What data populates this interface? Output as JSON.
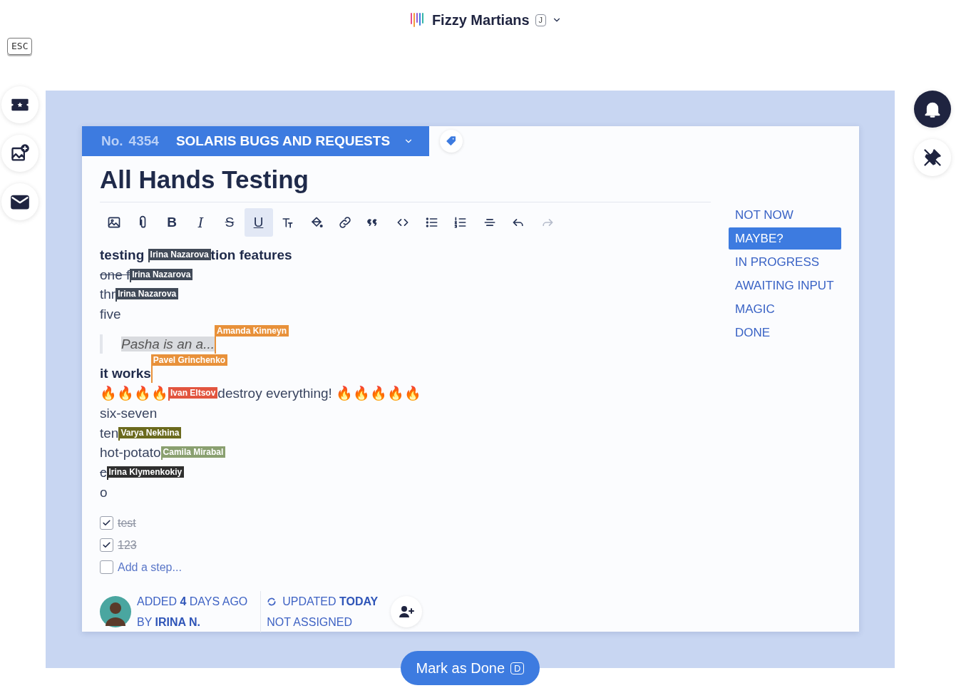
{
  "workspace": {
    "name": "Fizzy Martians",
    "shortcut": "J"
  },
  "escape_key": "ESC",
  "card": {
    "number_label": "No.",
    "number": "4354",
    "board": "SOLARIS BUGS AND REQUESTS",
    "title": "All Hands Testing"
  },
  "toolbar": [
    {
      "kind": "image",
      "active": false,
      "disabled": false
    },
    {
      "kind": "attach",
      "active": false,
      "disabled": false
    },
    {
      "kind": "letter",
      "label": "B",
      "active": false,
      "disabled": false
    },
    {
      "kind": "letter",
      "label": "I",
      "active": false,
      "disabled": false
    },
    {
      "kind": "letter",
      "label": "S",
      "active": false,
      "disabled": false
    },
    {
      "kind": "letter",
      "label": "U",
      "active": true,
      "disabled": false
    },
    {
      "kind": "textcolor",
      "active": false,
      "disabled": false
    },
    {
      "kind": "fill",
      "active": false,
      "disabled": false
    },
    {
      "kind": "link",
      "active": false,
      "disabled": false
    },
    {
      "kind": "quote",
      "active": false,
      "disabled": false
    },
    {
      "kind": "code",
      "active": false,
      "disabled": false
    },
    {
      "kind": "bullets",
      "active": false,
      "disabled": false
    },
    {
      "kind": "numbers",
      "active": false,
      "disabled": false
    },
    {
      "kind": "rule",
      "active": false,
      "disabled": false
    },
    {
      "kind": "undo",
      "active": false,
      "disabled": false
    },
    {
      "kind": "redo",
      "active": false,
      "disabled": true
    }
  ],
  "lines": [
    {
      "kind": "heading",
      "parts": [
        {
          "kind": "text",
          "text": "testing "
        },
        {
          "kind": "flag",
          "name": "Irina Nazarova",
          "color": "#414a58"
        },
        {
          "kind": "text",
          "text": "tion features"
        }
      ]
    },
    {
      "kind": "strike",
      "parts": [
        {
          "kind": "text",
          "text": "one f"
        },
        {
          "kind": "flag",
          "name": "Irina Nazarova",
          "color": "#414a58"
        }
      ]
    },
    {
      "kind": "plain",
      "parts": [
        {
          "kind": "text",
          "text": "thr"
        },
        {
          "kind": "flag",
          "name": "Irina Nazarova",
          "color": "#414a58"
        }
      ]
    },
    {
      "kind": "plain",
      "parts": [
        {
          "kind": "text",
          "text": "five"
        }
      ]
    },
    {
      "kind": "quote",
      "parts": [
        {
          "kind": "text",
          "text": "Pasha is an a..."
        },
        {
          "kind": "caret",
          "name": "Amanda Kinneyn",
          "color": "#e8913a"
        }
      ]
    },
    {
      "kind": "heading",
      "parts": [
        {
          "kind": "text",
          "text": "it works"
        },
        {
          "kind": "caret",
          "name": "Pavel Grinchenko",
          "color": "#e8913a"
        }
      ]
    },
    {
      "kind": "plain",
      "parts": [
        {
          "kind": "text",
          "text": "🔥🔥🔥🔥"
        },
        {
          "kind": "flag",
          "name": "Ivan Eltsov",
          "color": "#e2553f"
        },
        {
          "kind": "text",
          "text": "destroy everything! 🔥🔥🔥🔥🔥"
        }
      ]
    },
    {
      "kind": "plain",
      "parts": [
        {
          "kind": "text",
          "text": "six-seven"
        }
      ]
    },
    {
      "kind": "plain",
      "parts": [
        {
          "kind": "text",
          "text": "ten"
        },
        {
          "kind": "flag",
          "name": "Varya Nekhina",
          "color": "#6b6a1e"
        }
      ]
    },
    {
      "kind": "plain",
      "parts": [
        {
          "kind": "text",
          "text": "hot-potato"
        },
        {
          "kind": "flag",
          "name": "Camila Mirabal",
          "color": "#8aa070"
        }
      ]
    },
    {
      "kind": "strike",
      "parts": [
        {
          "kind": "text",
          "text": "c"
        },
        {
          "kind": "flag",
          "name": "Irina Klymenkokiy",
          "color": "#2f2f2f"
        }
      ]
    },
    {
      "kind": "plain",
      "parts": [
        {
          "kind": "text",
          "text": "o"
        }
      ]
    }
  ],
  "steps": [
    {
      "text": "test",
      "checked": true
    },
    {
      "text": "123",
      "checked": true
    }
  ],
  "new_step": {
    "placeholder": "Add a step...",
    "checked": false
  },
  "meta": {
    "added": "ADDED **4** DAYS AGO",
    "by": "BY **IRINA N.**",
    "updated": "UPDATED **TODAY**",
    "assigned": "NOT ASSIGNED"
  },
  "statuses": [
    {
      "label": "NOT NOW",
      "selected": false
    },
    {
      "label": "MAYBE?",
      "selected": true
    },
    {
      "label": "IN PROGRESS",
      "selected": false
    },
    {
      "label": "AWAITING INPUT",
      "selected": false
    },
    {
      "label": "MAGIC",
      "selected": false
    },
    {
      "label": "DONE",
      "selected": false
    }
  ],
  "done_button": {
    "label": "Mark as Done",
    "shortcut": "D"
  }
}
